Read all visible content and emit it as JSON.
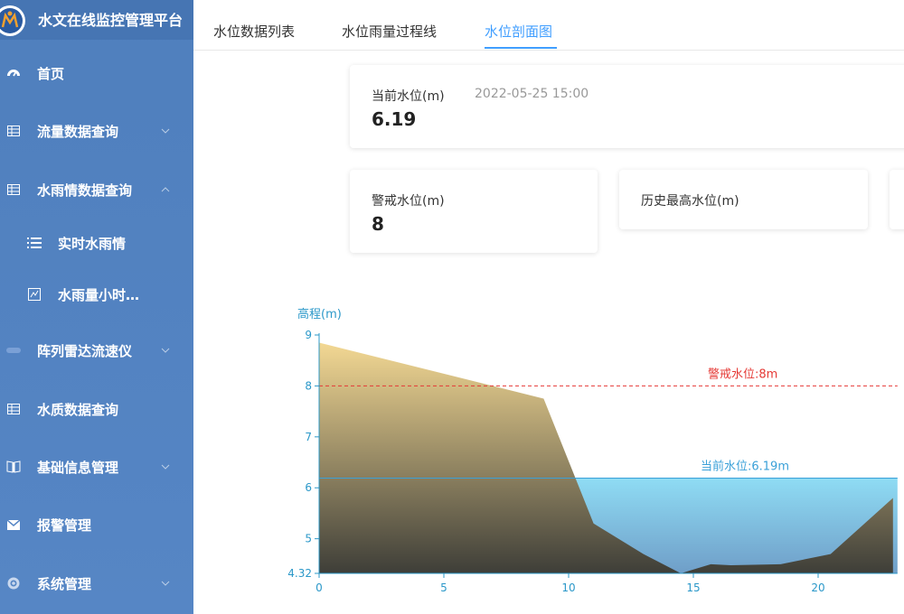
{
  "app": {
    "title": "水文在线监控管理平台"
  },
  "sidebar": {
    "items": [
      {
        "label": "首页",
        "icon": "dashboard-icon"
      },
      {
        "label": "流量数据查询",
        "icon": "table-icon",
        "has_arrow": true
      },
      {
        "label": "水雨情数据查询",
        "icon": "table-icon",
        "has_arrow": true,
        "expanded": true
      },
      {
        "label": "实时水雨情",
        "icon": "list-icon",
        "sub": true
      },
      {
        "label": "水雨量小时…",
        "icon": "chart-box-icon",
        "sub": true
      },
      {
        "label": "阵列雷达流速仪",
        "icon": "radar-icon",
        "has_arrow": true
      },
      {
        "label": "水质数据查询",
        "icon": "table-icon"
      },
      {
        "label": "基础信息管理",
        "icon": "book-icon",
        "has_arrow": true
      },
      {
        "label": "报警管理",
        "icon": "mail-icon"
      },
      {
        "label": "系统管理",
        "icon": "gear-icon",
        "has_arrow": true
      }
    ]
  },
  "tabs": [
    {
      "label": "水位数据列表"
    },
    {
      "label": "水位雨量过程线"
    },
    {
      "label": "水位剖面图",
      "active": true
    }
  ],
  "cards": {
    "current": {
      "label": "当前水位(m)",
      "time": "2022-05-25 15:00",
      "value": "6.19"
    },
    "warning": {
      "label": "警戒水位(m)",
      "value": "8"
    },
    "history": {
      "label": "历史最高水位(m)",
      "value": ""
    }
  },
  "chart_data": {
    "type": "area",
    "ylabel": "高程(m)",
    "y_ticks": [
      "4.32",
      "5",
      "6",
      "7",
      "8",
      "9"
    ],
    "x_ticks": [
      "0",
      "5",
      "10",
      "15",
      "20"
    ],
    "ylim": [
      4.32,
      9
    ],
    "xlim": [
      0,
      23
    ],
    "terrain": {
      "x": [
        0,
        9,
        11,
        13,
        14.5,
        15.7,
        16.5,
        18.5,
        20.5,
        23
      ],
      "y": [
        8.85,
        7.75,
        5.3,
        4.7,
        4.32,
        4.5,
        4.48,
        4.5,
        4.7,
        5.8
      ]
    },
    "warning_level": {
      "value": 8,
      "label": "警戒水位:8m",
      "color": "#e53935"
    },
    "current_level": {
      "value": 6.19,
      "label": "当前水位:6.19m",
      "color": "#3aa0d8"
    }
  }
}
